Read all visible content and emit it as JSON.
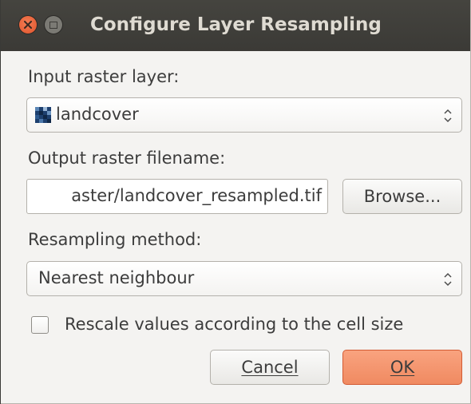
{
  "window": {
    "title": "Configure Layer Resampling"
  },
  "form": {
    "input_layer_label": "Input raster layer:",
    "input_layer_value": "landcover",
    "output_filename_label": "Output raster filename:",
    "output_filename_value": "aster/landcover_resampled.tif",
    "browse_label": "Browse...",
    "method_label": "Resampling method:",
    "method_value": "Nearest neighbour",
    "rescale_label": "Rescale values according to the cell size",
    "rescale_checked": false
  },
  "buttons": {
    "cancel_label": "Cancel",
    "ok_label": "OK"
  },
  "colors": {
    "titlebar": "#3c3b37",
    "close_button": "#e95420",
    "ok_button": "#f08a61",
    "dialog_background": "#f4f3f1"
  },
  "icons": {
    "close": "close-icon",
    "maximize": "maximize-icon",
    "layer": "raster-layer-icon",
    "combo_arrows": "up-down-arrows-icon"
  }
}
